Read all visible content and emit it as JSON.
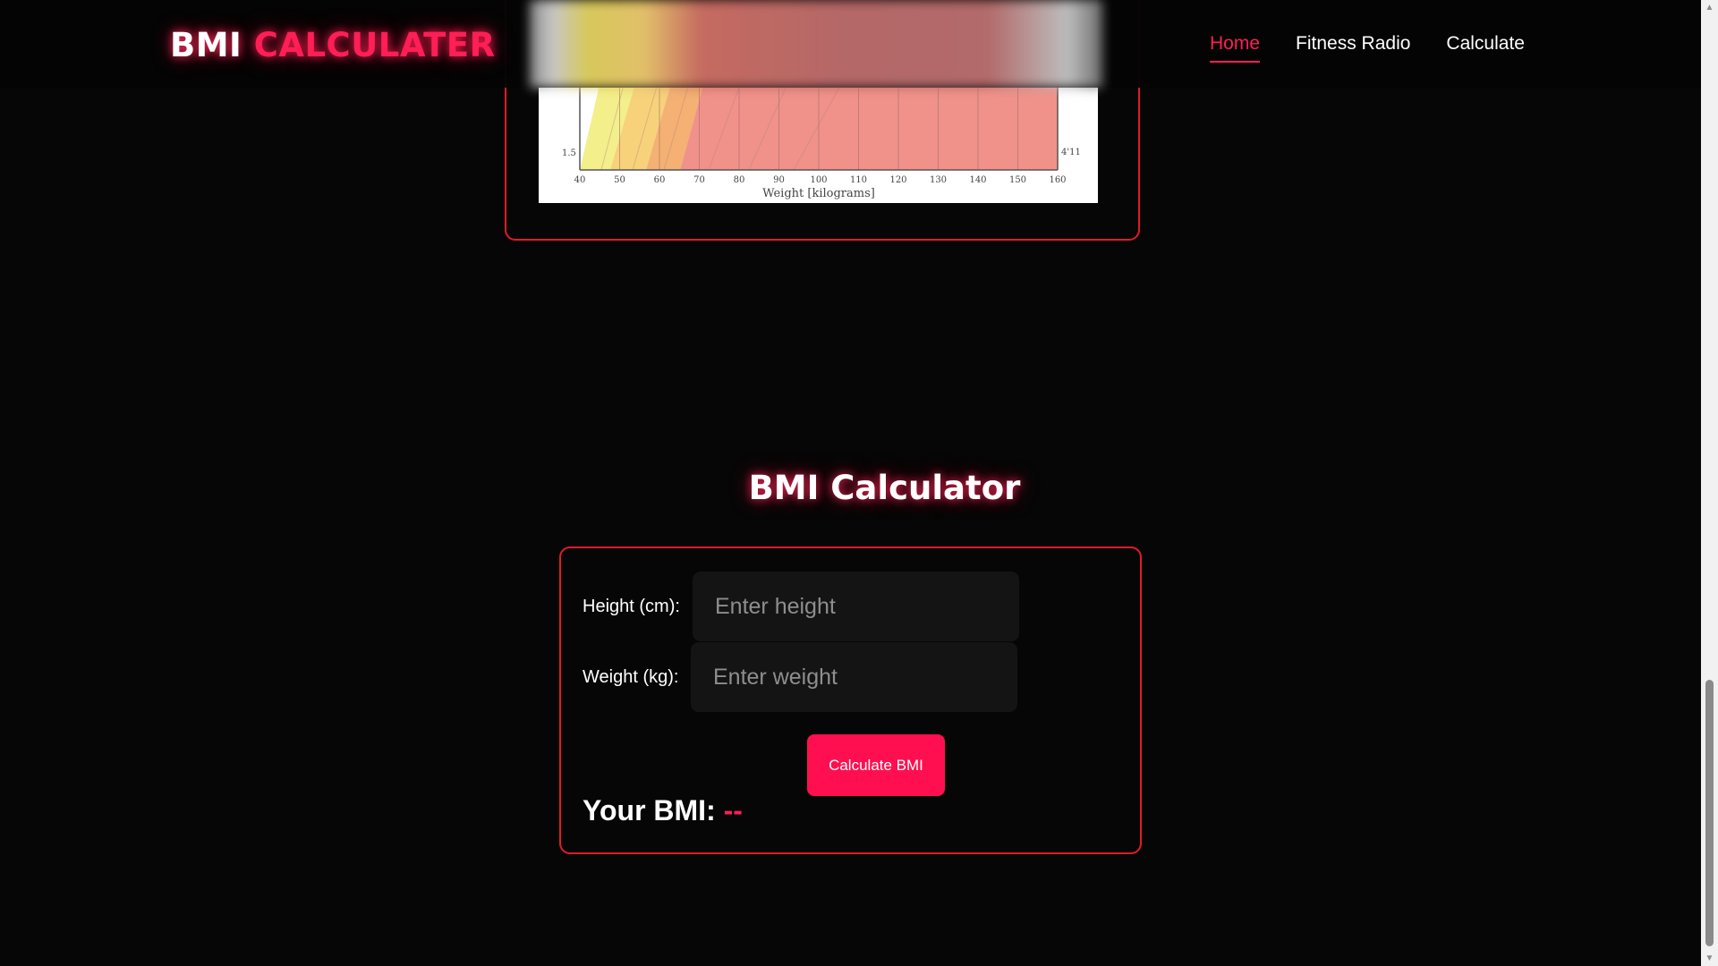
{
  "header": {
    "logo_part1": "BMI",
    "logo_part2": "CALCULATER",
    "nav": [
      {
        "label": "Home",
        "active": true
      },
      {
        "label": "Fitness Radio",
        "active": false
      },
      {
        "label": "Calculate",
        "active": false
      }
    ]
  },
  "chart_image": {
    "left_axis_label": "1.5",
    "right_axis_label": "4'11",
    "x_tick_labels": [
      "40",
      "50",
      "60",
      "70",
      "80",
      "90",
      "100",
      "110",
      "120",
      "130",
      "140",
      "150",
      "160"
    ],
    "x_axis_label": "Weight [kilograms]"
  },
  "calculator": {
    "title": "BMI Calculator",
    "height_label": "Height (cm):",
    "height_placeholder": "Enter height",
    "height_value": "",
    "weight_label": "Weight (kg):",
    "weight_placeholder": "Enter weight",
    "weight_value": "",
    "button_label": "Calculate BMI",
    "result_label": "Your BMI:",
    "result_value": "--"
  },
  "colors": {
    "accent": "#ff1e56",
    "card_border": "#e01a2b",
    "background": "#060606",
    "button": "#ff0f4f"
  }
}
